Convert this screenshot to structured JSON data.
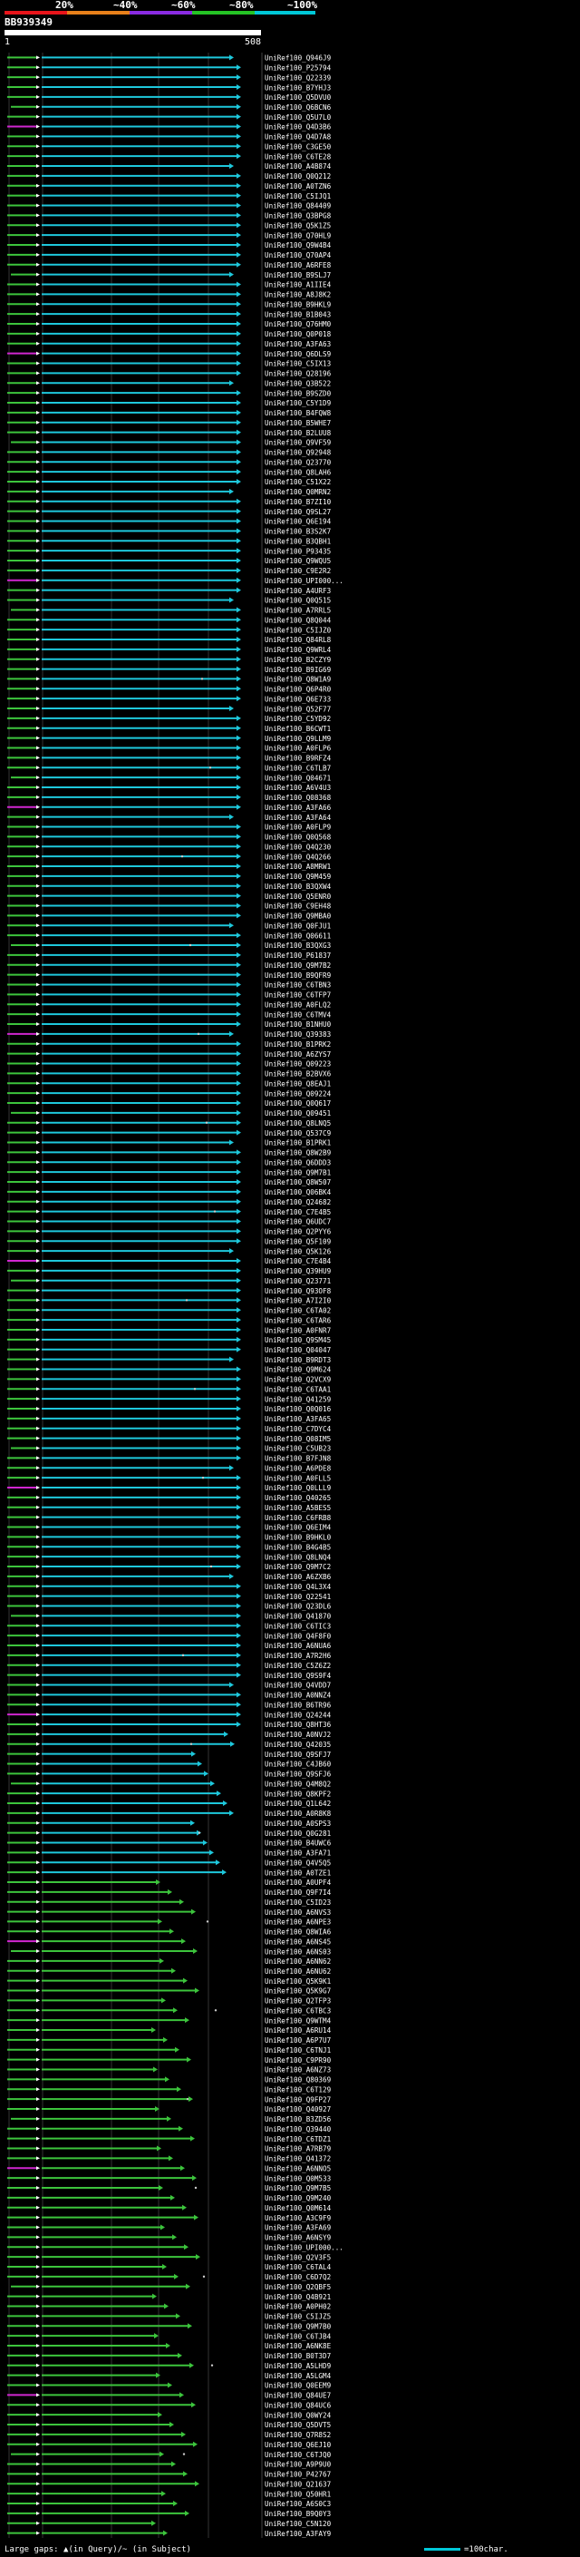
{
  "header": {
    "ticks": [
      "20%",
      "~40%",
      "~60%",
      "~80%",
      "~100%"
    ],
    "tick_colors": [
      "#e8141a",
      "#e8801a",
      "#8a2be2",
      "#25c425",
      "#00c8d8"
    ],
    "title": "BB939349",
    "query_start": "1",
    "query_end": "508"
  },
  "chart_data": {
    "type": "alignment-overview",
    "query_length": 508,
    "ids": [
      "UniRef100_Q946J9",
      "UniRef100_P25794",
      "UniRef100_Q22339",
      "UniRef100_B7YHJ3",
      "UniRef100_Q5DVU0",
      "UniRef100_Q6BCN6",
      "UniRef100_Q5U7L0",
      "UniRef100_Q4D3B6",
      "UniRef100_Q4D7A8",
      "UniRef100_C3GE50",
      "UniRef100_C6TE28",
      "UniRef100_A4B874",
      "UniRef100_Q0Q212",
      "UniRef100_A0TZN6",
      "UniRef100_C5IJQ1",
      "UniRef100_Q84409",
      "UniRef100_Q3BPG8",
      "UniRef100_Q5K1Z5",
      "UniRef100_Q70HL9",
      "UniRef100_Q9W4B4",
      "UniRef100_Q70AP4",
      "UniRef100_A6RFE8",
      "UniRef100_B9SLJ7",
      "UniRef100_A1IIE4",
      "UniRef100_A8J8K2",
      "UniRef100_B9HKL9",
      "UniRef100_B1B043",
      "UniRef100_Q76HM0",
      "UniRef100_Q0P018",
      "UniRef100_A3FA63",
      "UniRef100_Q6DLS9",
      "UniRef100_C5IX13",
      "UniRef100_Q28196",
      "UniRef100_Q3B522",
      "UniRef100_B9SZD0",
      "UniRef100_C5Y1D9",
      "UniRef100_B4FQW8",
      "UniRef100_B5WHE7",
      "UniRef100_B2LUU8",
      "UniRef100_Q9VF59",
      "UniRef100_Q92948",
      "UniRef100_Q23770",
      "UniRef100_Q8LAH6",
      "UniRef100_C51X22",
      "UniRef100_Q0MRN2",
      "UniRef100_B7ZI10",
      "UniRef100_Q9SL27",
      "UniRef100_Q6E194",
      "UniRef100_B3S2K7",
      "UniRef100_B3QBH1",
      "UniRef100_P93435",
      "UniRef100_Q9WQU5",
      "UniRef100_C9E2R2",
      "UniRef100_UPI000...",
      "UniRef100_A4URF3",
      "UniRef100_Q0Q515",
      "UniRef100_A7RRL5",
      "UniRef100_Q8Q044",
      "UniRef100_C5IJZ0",
      "UniRef100_Q84RL8",
      "UniRef100_Q9WRL4",
      "UniRef100_B2CZY9",
      "UniRef100_B9IG69",
      "UniRef100_Q8W1A9",
      "UniRef100_Q6P4R0",
      "UniRef100_Q6E733",
      "UniRef100_Q52F77",
      "UniRef100_C5YD92",
      "UniRef100_B6CWT1",
      "UniRef100_Q9LLM9",
      "UniRef100_A0FLP6",
      "UniRef100_B9RFZ4",
      "UniRef100_C6TLB7",
      "UniRef100_Q04671",
      "UniRef100_A6V4U3",
      "UniRef100_Q08368",
      "UniRef100_A3FA66",
      "UniRef100_A3FA64",
      "UniRef100_A0FLP9",
      "UniRef100_Q0Q568",
      "UniRef100_Q4Q230",
      "UniRef100_Q4Q266",
      "UniRef100_A8MRW1",
      "UniRef100_Q9M459",
      "UniRef100_B3QXW4",
      "UniRef100_Q5ENR0",
      "UniRef100_C9EH48",
      "UniRef100_Q9MBA0",
      "UniRef100_Q0FJU1",
      "UniRef100_Q06611",
      "UniRef100_B3QXG3",
      "UniRef100_P61837",
      "UniRef100_Q9M7B2",
      "UniRef100_B9QFR9",
      "UniRef100_C6TBN3",
      "UniRef100_C6TFP7",
      "UniRef100_A0FLQ2",
      "UniRef100_C6TMV4",
      "UniRef100_B1NHU0",
      "UniRef100_Q39383",
      "UniRef100_B1PRK2",
      "UniRef100_A6ZYS7",
      "UniRef100_Q09223",
      "UniRef100_B2BVX6",
      "UniRef100_Q8EAJ1",
      "UniRef100_Q09224",
      "UniRef100_Q0Q617",
      "UniRef100_Q09451",
      "UniRef100_Q8LNQ5",
      "UniRef100_Q537C9",
      "UniRef100_B1PRK1",
      "UniRef100_Q8W2B9",
      "UniRef100_Q6DDD3",
      "UniRef100_Q9M7B1",
      "UniRef100_Q8W507",
      "UniRef100_Q06BK4",
      "UniRef100_Q24682",
      "UniRef100_C7E4B5",
      "UniRef100_Q6UDC7",
      "UniRef100_Q2PYY6",
      "UniRef100_Q5F109",
      "UniRef100_Q5K126",
      "UniRef100_C7E4B4",
      "UniRef100_Q39HU9",
      "UniRef100_Q23771",
      "UniRef100_Q93OF8",
      "UniRef100_A7I2I0",
      "UniRef100_C6TA02",
      "UniRef100_C6TAR6",
      "UniRef100_A0FNR7",
      "UniRef100_Q9SM45",
      "UniRef100_Q04047",
      "UniRef100_B9RDT3",
      "UniRef100_Q9M624",
      "UniRef100_Q2VCX9",
      "UniRef100_C6TAA1",
      "UniRef100_Q41259",
      "UniRef100_Q0Q016",
      "UniRef100_A3FA65",
      "UniRef100_C7DYC4",
      "UniRef100_Q08IM5",
      "UniRef100_C5UB23",
      "UniRef100_B7FJN8",
      "UniRef100_A6PDE8",
      "UniRef100_A0FLL5",
      "UniRef100_Q0LLL9",
      "UniRef100_Q40265",
      "UniRef100_A5BES5",
      "UniRef100_C6FRB8",
      "UniRef100_Q6EIM4",
      "UniRef100_B9HKL0",
      "UniRef100_B4G4B5",
      "UniRef100_Q8LNQ4",
      "UniRef100_Q9M7C2",
      "UniRef100_A6ZXB6",
      "UniRef100_Q4L3X4",
      "UniRef100_Q22541",
      "UniRef100_Q23DL6",
      "UniRef100_Q41870",
      "UniRef100_C6TIC3",
      "UniRef100_Q4F8F0",
      "UniRef100_A6NUA6",
      "UniRef100_A7R2H6",
      "UniRef100_C5Z6Z2",
      "UniRef100_Q9S9F4",
      "UniRef100_Q4VDD7",
      "UniRef100_A0NNZ4",
      "UniRef100_B6TR96",
      "UniRef100_Q24244",
      "UniRef100_Q8HT36",
      "UniRef100_A0NVJ2",
      "UniRef100_Q42035",
      "UniRef100_Q9SFJ7",
      "UniRef100_C4JB60",
      "UniRef100_Q9SFJ6",
      "UniRef100_Q4M8Q2",
      "UniRef100_Q8KPF2",
      "UniRef100_Q1L642",
      "UniRef100_A0R8K8",
      "UniRef100_A0SPS3",
      "UniRef100_Q0G281",
      "UniRef100_B4UWC6",
      "UniRef100_A3FA71",
      "UniRef100_Q4V5Q5",
      "UniRef100_A0TZE1",
      "UniRef100_A0UPF4",
      "UniRef100_Q9F7I4",
      "UniRef100_C5ID23",
      "UniRef100_A6NVS3",
      "UniRef100_A6NPE3",
      "UniRef100_Q8WIA6",
      "UniRef100_A6NS45",
      "UniRef100_A6NS03",
      "UniRef100_A6NN62",
      "UniRef100_A6NU62",
      "UniRef100_Q5K9K1",
      "UniRef100_Q5K9G7",
      "UniRef100_Q2TFP3",
      "UniRef100_C6TBC3",
      "UniRef100_Q9WTM4",
      "UniRef100_A6RU14",
      "UniRef100_A6P7U7",
      "UniRef100_C6TNJ1",
      "UniRef100_C9PR90",
      "UniRef100_A6NZ73",
      "UniRef100_Q80369",
      "UniRef100_C6T129",
      "UniRef100_Q9FP27",
      "UniRef100_Q40927",
      "UniRef100_B3ZD56",
      "UniRef100_Q39440",
      "UniRef100_C6TDZ1",
      "UniRef100_A7RB79",
      "UniRef100_Q41372",
      "UniRef100_A6NNO5",
      "UniRef100_Q0M533",
      "UniRef100_Q9M7B5",
      "UniRef100_Q9M240",
      "UniRef100_Q0M614",
      "UniRef100_A3C9F9",
      "UniRef100_A3FA69",
      "UniRef100_A6NSY9",
      "UniRef100_UPI000...",
      "UniRef100_Q2V3F5",
      "UniRef100_C6TAL4",
      "UniRef100_C6D7Q2",
      "UniRef100_Q2QBF5",
      "UniRef100_Q4B921",
      "UniRef100_A0PH02",
      "UniRef100_C5IJZ5",
      "UniRef100_Q9M7B0",
      "UniRef100_C6TJB4",
      "UniRef100_A6NK8E",
      "UniRef100_B0T3D7",
      "UniRef100_A5LHD9",
      "UniRef100_A5LGM4",
      "UniRef100_Q0EEM9",
      "UniRef100_Q84UE7",
      "UniRef100_Q84UC6",
      "UniRef100_Q0WY24",
      "UniRef100_Q5DVT5",
      "UniRef100_Q7R8S2",
      "UniRef100_Q6EJ10",
      "UniRef100_C6TJQ0",
      "UniRef100_A9P9U0",
      "UniRef100_P42767",
      "UniRef100_Q21637",
      "UniRef100_Q50HR1",
      "UniRef100_A6S0C3",
      "UniRef100_B9Q0Y3",
      "UniRef100_C5N120",
      "UniRef100_A3FAY9"
    ]
  },
  "footer": {
    "legend_gaps": "Large gaps: ▲(in Query)/~ (in Subject)",
    "legend_scale": "=100char."
  }
}
